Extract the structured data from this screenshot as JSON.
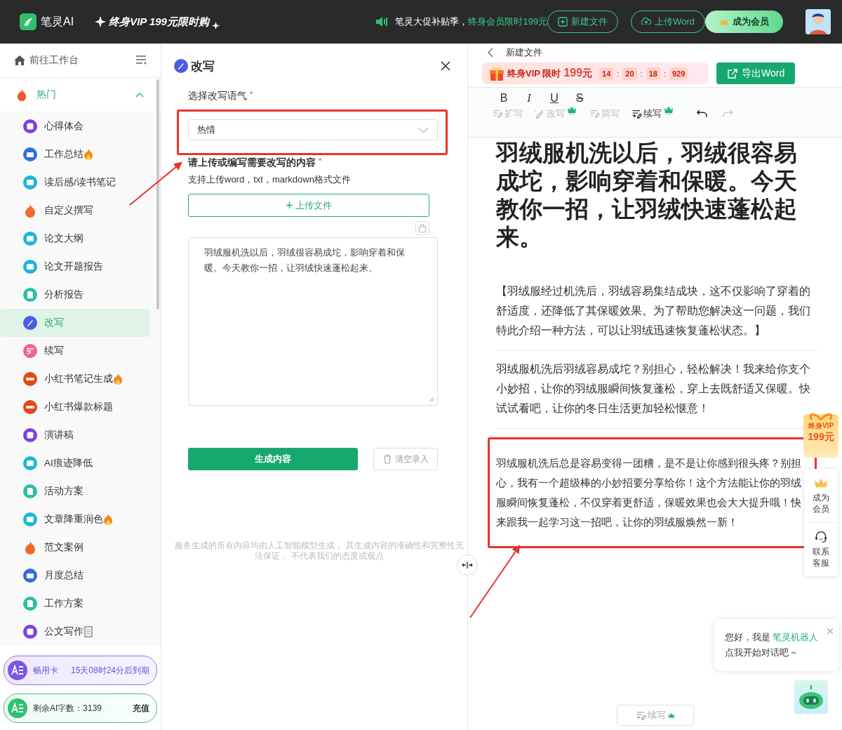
{
  "top_bar": {
    "logo": "笔灵AI",
    "promo": "终身VIP 199元限时购",
    "notice": "笔灵大促补贴季，",
    "notice_highlight": "终身会员限时199元",
    "buttons": [
      {
        "label": "新建文件",
        "kind": "new"
      },
      {
        "label": "上传Word",
        "kind": "upload"
      },
      {
        "label": "成为会员",
        "kind": "vip"
      }
    ]
  },
  "sidebar": {
    "workspace": "前往工作台",
    "group": {
      "label": "热门",
      "expanded": true
    },
    "items": [
      {
        "label": "心得体会",
        "kind": "star",
        "selected": false,
        "hot": false,
        "paper": false
      },
      {
        "label": "工作总结",
        "kind": "bag",
        "selected": false,
        "hot": true,
        "paper": false
      },
      {
        "label": "读后感/读书笔记",
        "kind": "book",
        "selected": false,
        "hot": false,
        "paper": false
      },
      {
        "label": "自定义撰写",
        "kind": "hot",
        "selected": false,
        "hot": false,
        "paper": false
      },
      {
        "label": "论文大纲",
        "kind": "book",
        "selected": false,
        "hot": false,
        "paper": false
      },
      {
        "label": "论文开题报告",
        "kind": "book",
        "selected": false,
        "hot": false,
        "paper": false
      },
      {
        "label": "分析报告",
        "kind": "doc",
        "selected": false,
        "hot": false,
        "paper": false
      },
      {
        "label": "改写",
        "kind": "pen",
        "selected": true,
        "hot": false,
        "paper": false
      },
      {
        "label": "续写",
        "kind": "write",
        "selected": false,
        "hot": false,
        "paper": false
      },
      {
        "label": "小红书笔记生成",
        "kind": "xhs",
        "selected": false,
        "hot": true,
        "paper": false
      },
      {
        "label": "小红书爆款标题",
        "kind": "xhs",
        "selected": false,
        "hot": false,
        "paper": false
      },
      {
        "label": "演讲稿",
        "kind": "star",
        "selected": false,
        "hot": false,
        "paper": false
      },
      {
        "label": "AI痕迹降低",
        "kind": "book",
        "selected": false,
        "hot": false,
        "paper": false
      },
      {
        "label": "活动方案",
        "kind": "doc",
        "selected": false,
        "hot": false,
        "paper": false
      },
      {
        "label": "文章降重润色",
        "kind": "book",
        "selected": false,
        "hot": true,
        "paper": false
      },
      {
        "label": "范文案例",
        "kind": "hot",
        "selected": false,
        "hot": false,
        "paper": false
      },
      {
        "label": "月度总结",
        "kind": "bag",
        "selected": false,
        "hot": false,
        "paper": false
      },
      {
        "label": "工作方案",
        "kind": "doc",
        "selected": false,
        "hot": false,
        "paper": false
      },
      {
        "label": "公文写作",
        "kind": "star",
        "selected": false,
        "hot": false,
        "paper": true
      }
    ],
    "cards": [
      {
        "kind": "pass",
        "name": "畅用卡",
        "info": "15天08时24分后到期"
      },
      {
        "kind": "words",
        "name": "剩余AI字数：3139",
        "action": "充值"
      }
    ]
  },
  "rewrite_panel": {
    "title": "改写",
    "tone_label": "选择改写语气",
    "tone_required": "*",
    "tone_value": "热情",
    "content_label": "请上传或编写需要改写的内容",
    "content_required": "*",
    "content_hint": "支持上传word，txt，markdown格式文件",
    "upload_button": "上传文件",
    "text": "羽绒服机洗以后，羽绒很容易成坨，影响穿着和保暖。今天教你一招，让羽绒快速蓬松起来。",
    "generate_button": "生成内容",
    "clear_button": "清空录入",
    "disclaimer": "服务生成的所有内容均由人工智能模型生成， 其生成内容的准确性和完整性无法保证， 不代表我们的态度或观点"
  },
  "editor": {
    "file_title": "新建文件",
    "promo_text": "终身VIP 限时",
    "promo_price": "199",
    "promo_unit": "元",
    "timer": [
      "14",
      "20",
      "18",
      "929"
    ],
    "timer_separator": ":",
    "export_button": "导出Word",
    "format_buttons": [
      {
        "label": "B",
        "kind": "bold"
      },
      {
        "label": "I",
        "kind": "italic"
      },
      {
        "label": "U",
        "kind": "underline"
      },
      {
        "label": "S",
        "kind": "strike"
      }
    ],
    "tools": [
      {
        "label": "扩写",
        "kind": "expand",
        "disabled": true,
        "vip": false
      },
      {
        "label": "改写",
        "kind": "rewrite",
        "disabled": true,
        "vip": true
      },
      {
        "label": "简写",
        "kind": "shorten",
        "disabled": true,
        "vip": false
      },
      {
        "label": "续写",
        "kind": "continue",
        "disabled": false,
        "vip": true
      }
    ],
    "undo_disabled": false,
    "redo_disabled": true,
    "heading": "羽绒服机洗以后，羽绒很容易成坨，影响穿着和保暖。今天教你一招，让羽绒快速蓬松起来。",
    "paragraphs": [
      "【羽绒服经过机洗后，羽绒容易集结成块，这不仅影响了穿着的舒适度，还降低了其保暖效果。为了帮助您解决这一问题，我们特此介绍一种方法，可以让羽绒迅速恢复蓬松状态。】",
      "羽绒服机洗后羽绒容易成坨？别担心，轻松解决！我来给你支个小妙招，让你的羽绒服瞬间恢复蓬松，穿上去既舒适又保暖。快试试看吧，让你的冬日生活更加轻松惬意！",
      "羽绒服机洗后总是容易变得一团糟，是不是让你感到很头疼？别担心，我有一个超级棒的小妙招要分享给你！这个方法能让你的羽绒服瞬间恢复蓬松，不仅穿着更舒适，保暖效果也会大大提升哦！快来跟我一起学习这一招吧，让你的羽绒服焕然一新！"
    ],
    "bottom_button": "续写"
  },
  "float": {
    "vip_title": "终身VIP",
    "vip_price": "199元",
    "side_items": [
      {
        "label": "成为会员",
        "kind": "crown"
      },
      {
        "label": "联系客服",
        "kind": "headset"
      }
    ],
    "chat": {
      "greeting": "您好，我是 ",
      "bot_name": "笔灵机器人",
      "prompt": "点我开始对话吧 ~"
    }
  }
}
